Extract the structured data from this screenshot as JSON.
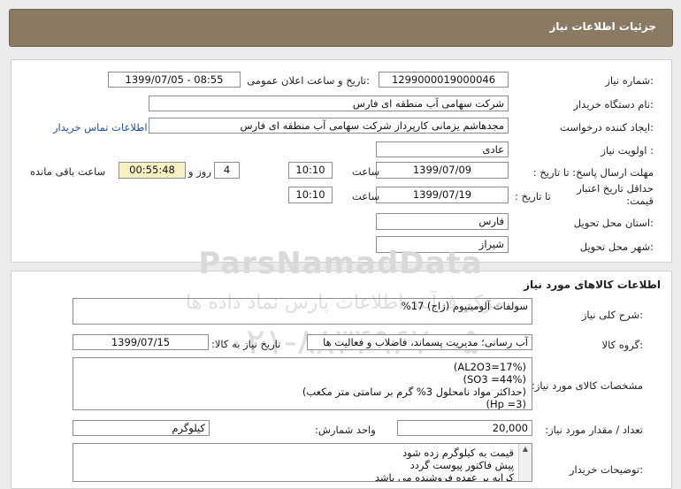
{
  "header": {
    "title": "جزئیات اطلاعات نیاز"
  },
  "need": {
    "need_number_label": "شماره نیاز:",
    "need_number": "1299000019000046",
    "announce_label": "تاریخ و ساعت اعلان عمومی:",
    "announce_value": "1399/07/05 - 08:55",
    "buyer_org_label": "نام دستگاه خریدار:",
    "buyer_org": "شرکت سهامی آب منطقه ای فارس",
    "requester_label": "ایجاد کننده درخواست:",
    "requester": "مجدهاشم یزمانی کارپرداز شرکت سهامی آب منطقه ای فارس",
    "contact_link": "اطلاعات تماس خریدار",
    "priority_label": "اولویت نیاز :",
    "priority": "عادی",
    "deadline_label": "مهلت ارسال پاسخ:  تا تاریخ :",
    "deadline_date": "1399/07/09",
    "time_label": "ساعت",
    "deadline_time": "10:10",
    "days_count": "4",
    "days_label": "روز و",
    "remaining_time": "00:55:48",
    "remaining_label": "ساعت باقی مانده",
    "validity_label": "حداقل تاریخ اعتبار قیمت:",
    "validity_to_label": "تا تاریخ :",
    "validity_date": "1399/07/19",
    "validity_time": "10:10",
    "province_label": "استان محل تحویل:",
    "province": "فارس",
    "city_label": "شهر محل تحویل:",
    "city": "شیراز"
  },
  "goods": {
    "section_title": "اطلاعات کالاهای مورد نیاز",
    "summary_label": "شرح کلی نیاز:",
    "summary": "سولفات آلومینیوم (زاج) 17%",
    "group_label": "گروه کالا:",
    "group": "آب رسانی؛ مدیریت پسماند، فاضلاب و فعالیت ها",
    "need_date_label": "تاریخ نیاز به کالا:",
    "need_date": "1399/07/15",
    "spec_label": "مشخصات کالای مورد نیاز:",
    "spec_lines": [
      "(AL2O3=17%)",
      "(SO3 =44%)",
      "(حداکثر مواد نامحلول 3% گرم بر سامتی متر مکعب)",
      "(Hp =3)"
    ],
    "quantity_label": "تعداد / مقدار مورد نیاز:",
    "quantity": "20,000",
    "unit_label": "واحد شمارش:",
    "unit": "کیلوگرم",
    "buyer_notes_label": "توضیحات خریدار:",
    "buyer_notes": [
      "قیمت به کیلوگرم زده شود",
      "پیش فاکتور پیوست گردد",
      "کرایه بر عهده فروشنده می باشد"
    ]
  },
  "watermark": {
    "brand": "ParsNamadData",
    "slogan": "مرکز فرآیند اطلاعات پارس نماد داده ها",
    "phone": "۰۲۱-۸۸۳۴۹۶۷۰-۵"
  }
}
